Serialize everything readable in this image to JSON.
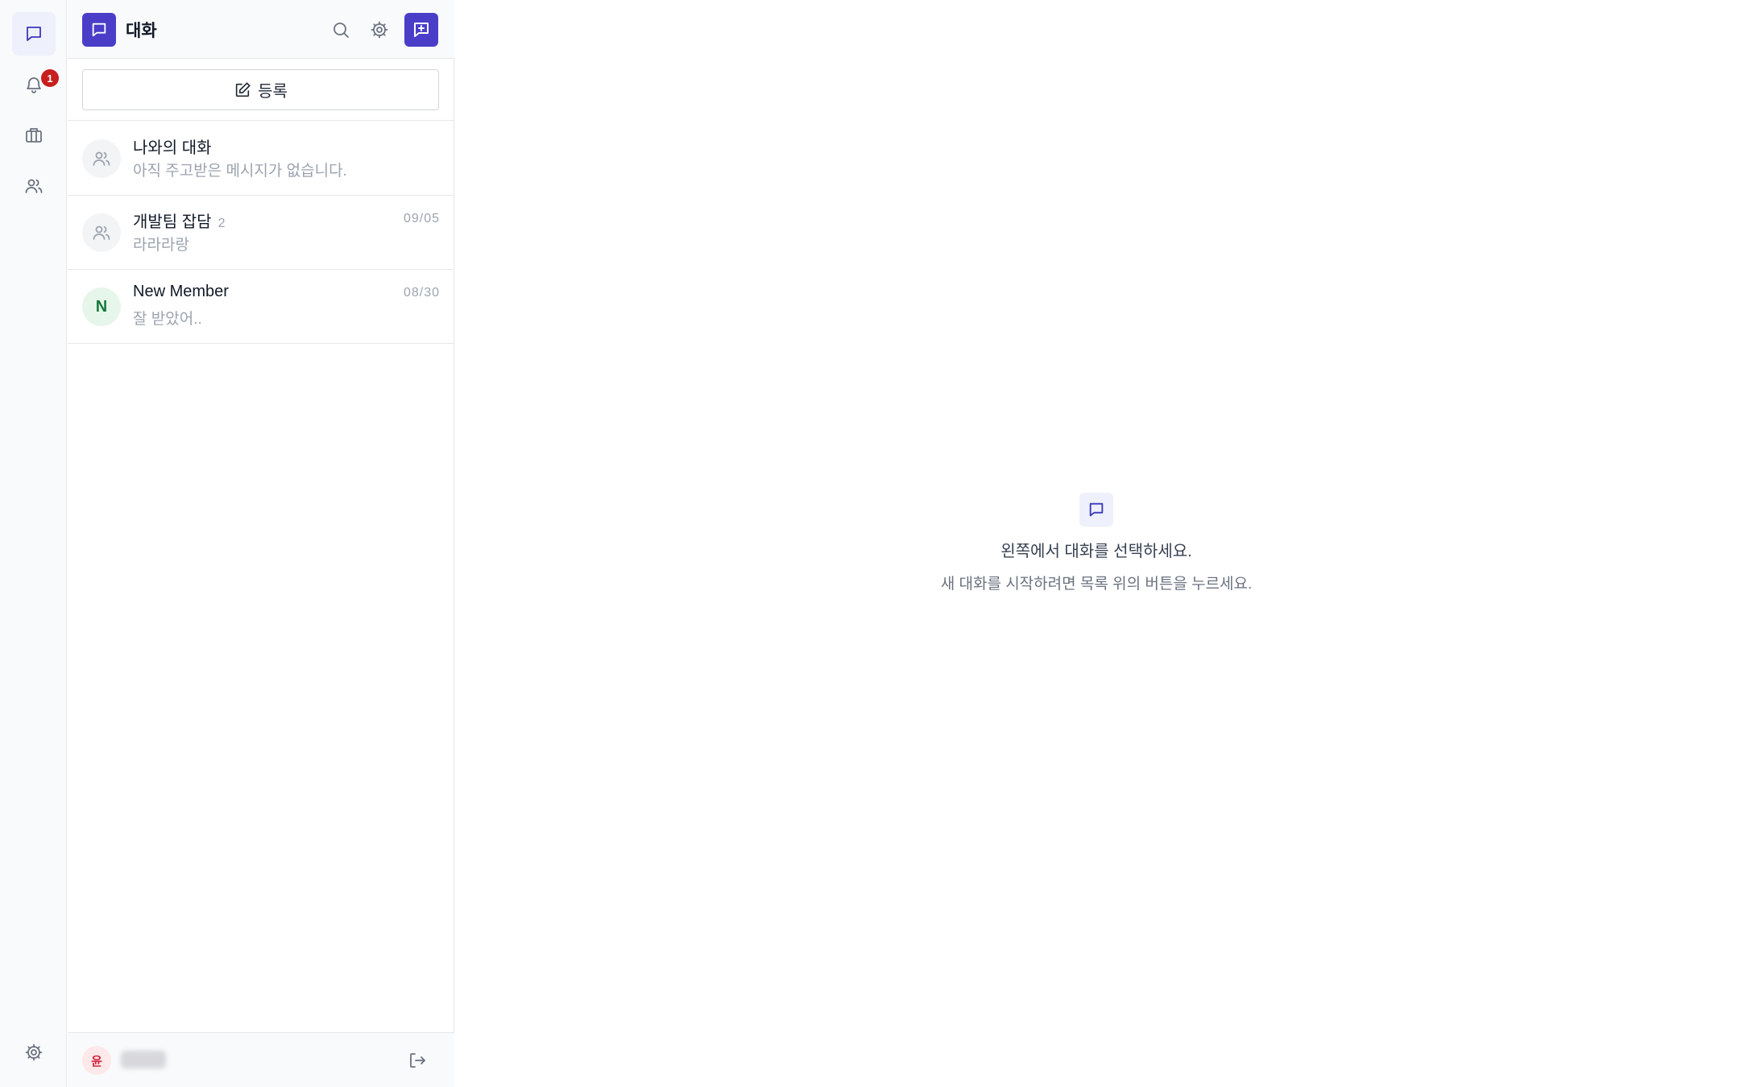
{
  "rail": {
    "items": [
      {
        "name": "chat",
        "icon": "chat-icon",
        "active": true
      },
      {
        "name": "notifications",
        "icon": "bell-icon",
        "badge": "1"
      },
      {
        "name": "work",
        "icon": "briefcase-icon"
      },
      {
        "name": "members",
        "icon": "users-icon"
      }
    ],
    "settings_icon": "gear-icon"
  },
  "panel": {
    "title": "대화",
    "register_label": "등록",
    "conversations": [
      {
        "name": "나와의 대화",
        "count": "",
        "date": "",
        "preview": "아직 주고받은 메시지가 없습니다.",
        "avatar": "users-icon"
      },
      {
        "name": "개발팀 잡담",
        "count": "2",
        "date": "09/05",
        "preview": "라라라랑",
        "avatar": "users-icon"
      },
      {
        "name": "New Member",
        "count": "",
        "date": "08/30",
        "preview": "잘 받았어..",
        "avatar_letter": "N"
      }
    ],
    "footer": {
      "user_initial": "윤"
    }
  },
  "empty_state": {
    "title": "왼쪽에서 대화를 선택하세요.",
    "subtitle": "새 대화를 시작하려면 목록 위의 버튼을 누르세요."
  },
  "colors": {
    "accent": "#4a3ec9",
    "badge": "#c81e1e",
    "muted_text": "#9ca3af"
  }
}
